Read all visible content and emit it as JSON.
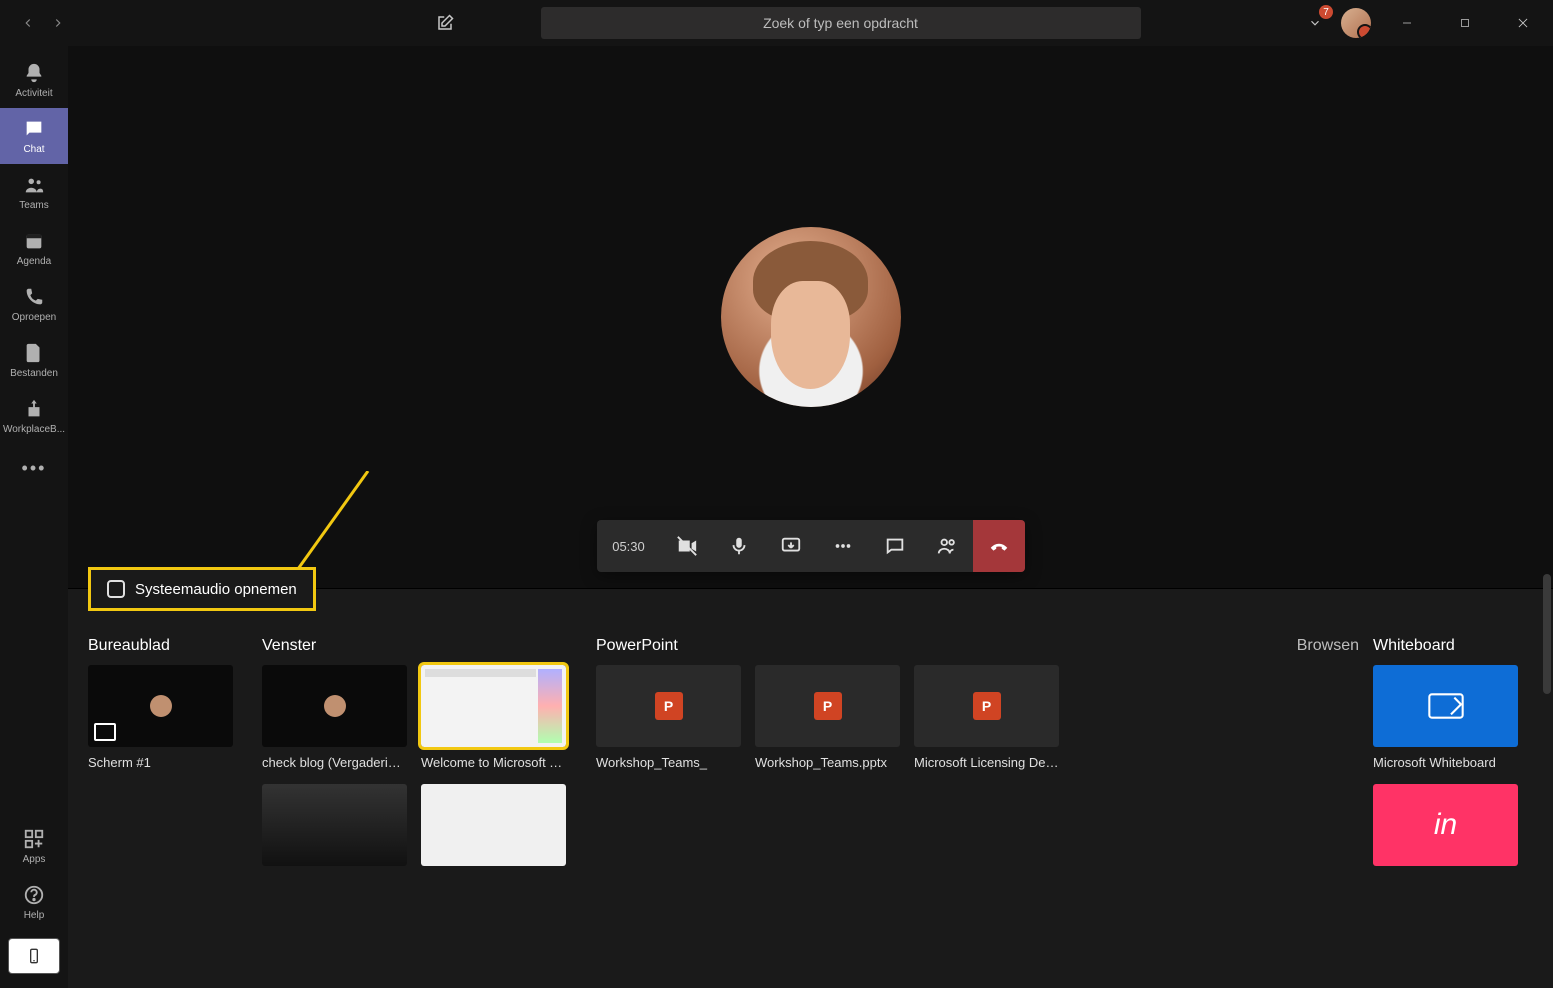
{
  "titlebar": {
    "search_placeholder": "Zoek of typ een opdracht",
    "notification_count": "7"
  },
  "sidebar": {
    "items": [
      {
        "label": "Activiteit"
      },
      {
        "label": "Chat"
      },
      {
        "label": "Teams"
      },
      {
        "label": "Agenda"
      },
      {
        "label": "Oproepen"
      },
      {
        "label": "Bestanden"
      },
      {
        "label": "WorkplaceB..."
      }
    ],
    "apps_label": "Apps",
    "help_label": "Help"
  },
  "call": {
    "duration": "05:30"
  },
  "share": {
    "system_audio_label": "Systeemaudio opnemen",
    "headings": {
      "desktop": "Bureaublad",
      "window": "Venster",
      "powerpoint": "PowerPoint",
      "browse": "Browsen",
      "whiteboard": "Whiteboard"
    },
    "desktop_items": [
      {
        "label": "Scherm #1"
      }
    ],
    "window_items": [
      {
        "label": "check blog (Vergadering)..."
      },
      {
        "label": "Welcome to Microsoft Te..."
      }
    ],
    "ppt_items": [
      {
        "label": "Workshop_Teams_"
      },
      {
        "label": "Workshop_Teams.pptx"
      },
      {
        "label": "Microsoft Licensing Deck..."
      }
    ],
    "whiteboard_items": [
      {
        "label": "Microsoft Whiteboard"
      }
    ]
  }
}
